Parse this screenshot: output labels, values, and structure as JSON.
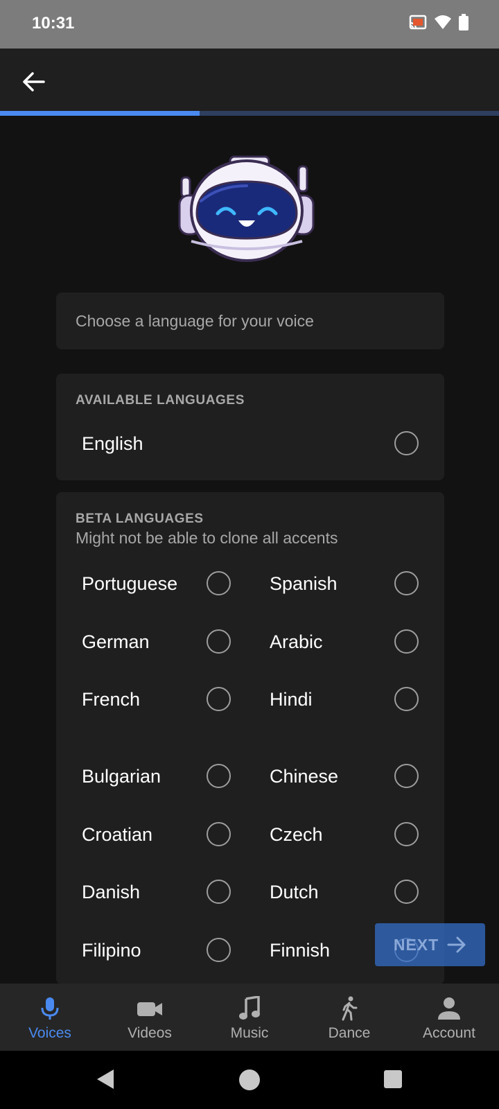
{
  "status_bar": {
    "time": "10:31"
  },
  "header": {
    "back_icon": "arrow-left-icon"
  },
  "progress": {
    "fraction": 0.4,
    "fill_color": "#4a8af0",
    "track_color": "#2e3f60"
  },
  "prompt": {
    "text": "Choose a language for your voice"
  },
  "available": {
    "title": "AVAILABLE LANGUAGES",
    "languages": [
      "English"
    ]
  },
  "beta": {
    "title": "BETA LANGUAGES",
    "subtitle": "Might not be able to clone all accents",
    "languages": [
      [
        "Portuguese",
        "Spanish"
      ],
      [
        "German",
        "Arabic"
      ],
      [
        "French",
        "Hindi"
      ],
      [
        "Bulgarian",
        "Chinese"
      ],
      [
        "Croatian",
        "Czech"
      ],
      [
        "Danish",
        "Dutch"
      ],
      [
        "Filipino",
        "Finnish"
      ]
    ]
  },
  "next_button": {
    "label": "NEXT"
  },
  "bottom_nav": {
    "items": [
      {
        "label": "Voices",
        "icon": "microphone-icon",
        "active": true
      },
      {
        "label": "Videos",
        "icon": "video-camera-icon",
        "active": false
      },
      {
        "label": "Music",
        "icon": "music-note-icon",
        "active": false
      },
      {
        "label": "Dance",
        "icon": "walking-person-icon",
        "active": false
      },
      {
        "label": "Account",
        "icon": "person-icon",
        "active": false
      }
    ]
  },
  "colors": {
    "accent": "#4a8af0",
    "card": "#1f1f1f",
    "background": "#121212"
  }
}
